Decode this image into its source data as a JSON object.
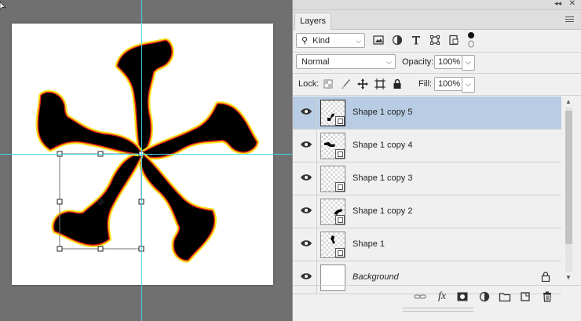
{
  "panel": {
    "title": "Layers",
    "filter": {
      "kind_label": "Kind"
    },
    "blend_mode": "Normal",
    "opacity_label": "Opacity:",
    "opacity_value": "100%",
    "lock_label": "Lock:",
    "fill_label": "Fill:",
    "fill_value": "100%"
  },
  "layers": [
    {
      "name": "Shape 1 copy 5",
      "selected": true
    },
    {
      "name": "Shape 1 copy 4",
      "selected": false
    },
    {
      "name": "Shape 1 copy 3",
      "selected": false
    },
    {
      "name": "Shape 1 copy 2",
      "selected": false
    },
    {
      "name": "Shape 1",
      "selected": false
    },
    {
      "name": "Background",
      "selected": false,
      "locked": true
    }
  ],
  "colors": {
    "guide": "#3fd6e6",
    "selection": "#b8cde4",
    "shape_fill": "#000000",
    "shape_stroke_inner": "#e8251a",
    "shape_stroke_outer": "#f6e21a"
  }
}
